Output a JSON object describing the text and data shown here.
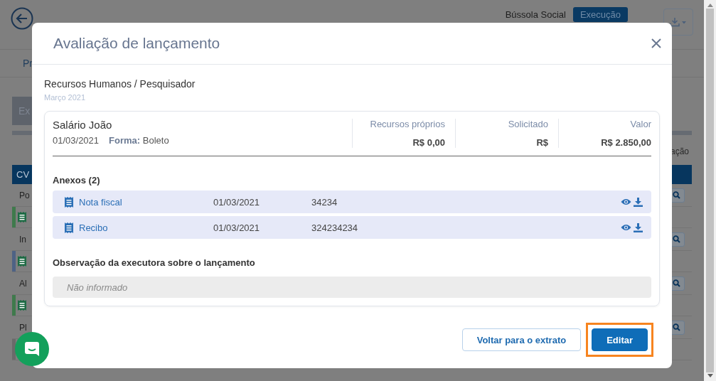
{
  "background": {
    "header": {
      "brand": "Bússola Social",
      "status_badge": "Execução"
    },
    "tab": "Pr",
    "panel_tab": "Ex",
    "table": {
      "first_column": "CV",
      "last_column": "ação",
      "rows": [
        {
          "label": "Po",
          "color": "#3f7a4c",
          "receipt": true
        },
        {
          "label": "In",
          "color": "#4e6285",
          "receipt": true
        },
        {
          "label": "Al",
          "color": "#3f7a4c",
          "receipt": true
        },
        {
          "label": "Pl",
          "color": "#6a6a6a"
        }
      ]
    }
  },
  "modal": {
    "title": "Avaliação de lançamento",
    "category": "Recursos Humanos / Pesquisador",
    "month": "Março 2021",
    "entry": {
      "name": "Salário João",
      "date": "01/03/2021",
      "method_label": "Forma:",
      "method": "Boleto",
      "amounts": [
        {
          "label": "Recursos próprios",
          "value": "R$ 0,00"
        },
        {
          "label": "Solicitado",
          "value": "R$"
        },
        {
          "label": "Valor",
          "value": "R$ 2.850,00"
        }
      ],
      "attachments_title": "Anexos (2)",
      "attachments": [
        {
          "name": "Nota fiscal",
          "date": "01/03/2021",
          "number": "34234"
        },
        {
          "name": "Recibo",
          "date": "01/03/2021",
          "number": "324234234"
        }
      ],
      "note_title": "Observação da executora sobre o lançamento",
      "note": "Não informado"
    },
    "buttons": [
      {
        "label": "Voltar para o extrato",
        "kind": "secondary"
      },
      {
        "label": "Editar",
        "kind": "primary",
        "highlighted": true
      }
    ]
  }
}
